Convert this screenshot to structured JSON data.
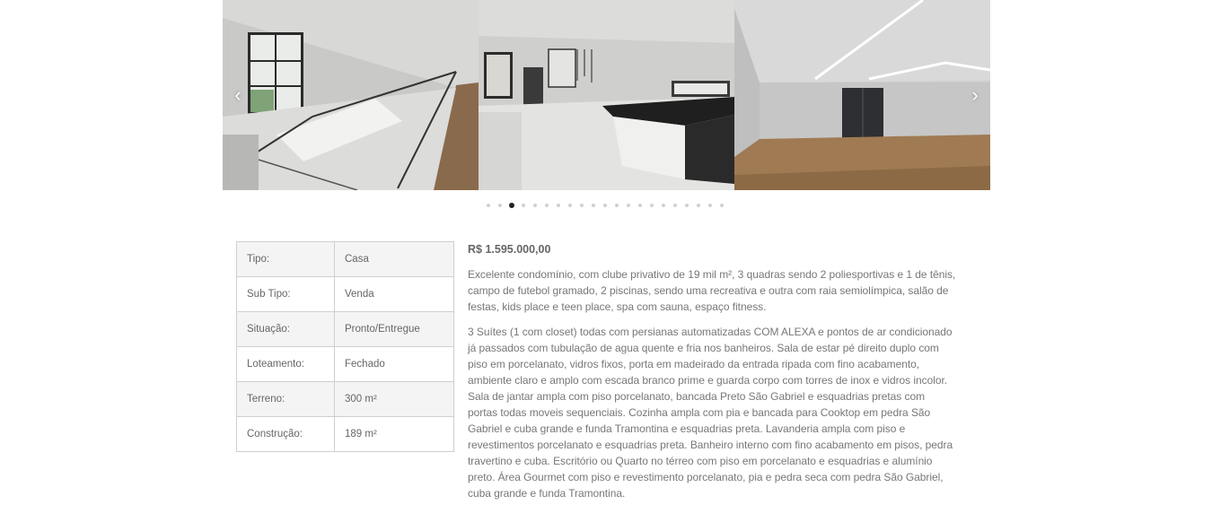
{
  "gallery": {
    "prev_label": "‹",
    "next_label": "›",
    "photos": [
      {
        "alt": "Mezanino com guarda-corpo de vidro e escada"
      },
      {
        "alt": "Cozinha com ilha em pedra preta"
      },
      {
        "alt": "Sala com piso de madeira e iluminação em LED"
      }
    ],
    "dot_count": 21,
    "active_dot": 2
  },
  "property": {
    "specs": [
      {
        "label": "Tipo:",
        "value": "Casa"
      },
      {
        "label": "Sub Tipo:",
        "value": "Venda"
      },
      {
        "label": "Situação:",
        "value": "Pronto/Entregue"
      },
      {
        "label": "Loteamento:",
        "value": "Fechado"
      },
      {
        "label": "Terreno:",
        "value": "300 m²"
      },
      {
        "label": "Construção:",
        "value": "189 m²"
      }
    ],
    "price": "R$ 1.595.000,00",
    "description_1": "Excelente condomínio, com clube privativo de 19 mil m², 3 quadras sendo 2 poliesportivas e 1 de tênis, campo de futebol gramado, 2 piscinas, sendo uma recreativa e outra com raia semiolímpica, salão de festas, kids place e teen place, spa com sauna, espaço fitness.",
    "description_2": "3 Suítes (1 com closet) todas com persianas automatizadas COM ALEXA e pontos de ar condicionado já passados com tubulação de agua quente e fria nos banheiros. Sala de estar pé direito duplo com piso em porcelanato, vidros fixos, porta em madeirado da entrada ripada com fino acabamento, ambiente claro e amplo com escada branco prime e guarda corpo com torres de inox e vidros incolor. Sala de jantar ampla com piso porcelanato, bancada Preto São Gabriel e esquadrias pretas com portas todas moveis sequenciais. Cozinha ampla com pia e bancada para Cooktop em pedra São Gabriel e cuba grande e funda Tramontina e esquadrias preta. Lavanderia ampla com piso e revestimentos porcelanato e esquadrias preta. Banheiro interno com fino acabamento em pisos, pedra travertino e cuba. Escritório ou Quarto no térreo com piso em porcelanato e esquadrias e alumínio preto. Área Gourmet com piso e revestimento porcelanato, pia e pedra seca com pedra São Gabriel, cuba grande e funda Tramontina."
  }
}
